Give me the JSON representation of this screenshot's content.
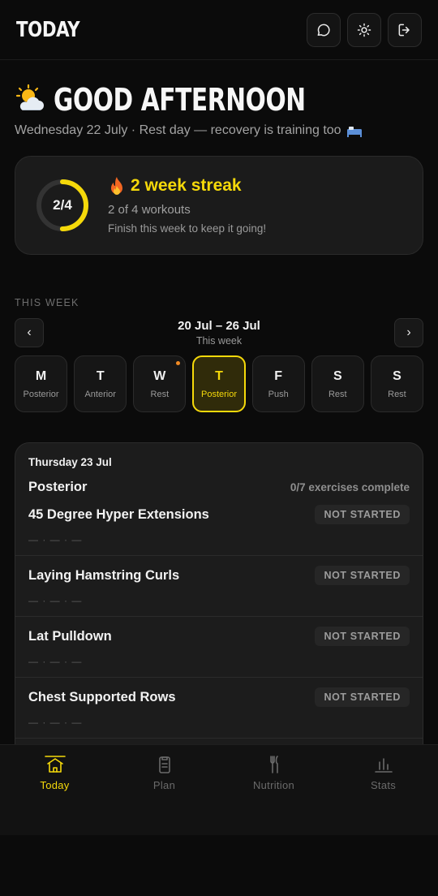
{
  "header": {
    "title": "TODAY",
    "actions": [
      "chat-icon",
      "theme-toggle-icon",
      "logout-icon"
    ]
  },
  "greeting": {
    "icon": "partly-sunny-icon",
    "text": "GOOD AFTERNOON",
    "subline": "Wednesday 22 July · Rest day — recovery is training too"
  },
  "streak": {
    "completed": 2,
    "target": 4,
    "ring_label": "2/4",
    "title": "2 week streak",
    "count_text": "2 of 4 workouts",
    "hint": "Finish this week to keep it going!",
    "accent": "#f5d90a"
  },
  "week": {
    "section_label": "THIS WEEK",
    "range": "20 Jul – 26 Jul",
    "caption": "This week",
    "prev": "‹",
    "next": "›",
    "days": [
      {
        "letter": "M",
        "type": "Posterior",
        "active": false,
        "dot": false
      },
      {
        "letter": "T",
        "type": "Anterior",
        "active": false,
        "dot": false
      },
      {
        "letter": "W",
        "type": "Rest",
        "active": false,
        "dot": true
      },
      {
        "letter": "T",
        "type": "Posterior",
        "active": true,
        "dot": false
      },
      {
        "letter": "F",
        "type": "Push",
        "active": false,
        "dot": false
      },
      {
        "letter": "S",
        "type": "Rest",
        "active": false,
        "dot": false
      },
      {
        "letter": "S",
        "type": "Rest",
        "active": false,
        "dot": false
      }
    ]
  },
  "workout": {
    "date": "Thursday 23 Jul",
    "title": "Posterior",
    "progress": "0/7 exercises complete",
    "exercises": [
      {
        "name": "45 Degree Hyper Extensions",
        "status": "NOT STARTED",
        "meta": "— · — · —"
      },
      {
        "name": "Laying Hamstring Curls",
        "status": "NOT STARTED",
        "meta": "— · — · —"
      },
      {
        "name": "Lat Pulldown",
        "status": "NOT STARTED",
        "meta": "— · — · —"
      },
      {
        "name": "Chest Supported Rows",
        "status": "NOT STARTED",
        "meta": "— · — · —"
      }
    ]
  },
  "bottom_nav": [
    {
      "label": "Today",
      "icon": "home-icon",
      "active": true
    },
    {
      "label": "Plan",
      "icon": "clipboard-icon",
      "active": false
    },
    {
      "label": "Nutrition",
      "icon": "cutlery-icon",
      "active": false
    },
    {
      "label": "Stats",
      "icon": "bar-chart-icon",
      "active": false
    }
  ]
}
